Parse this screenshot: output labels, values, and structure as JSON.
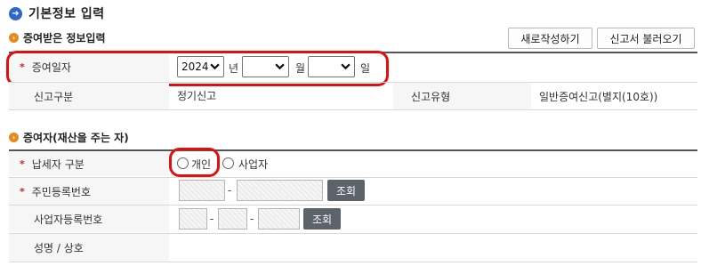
{
  "page": {
    "title": "기본정보 입력",
    "title_icon": "arrow-right-icon"
  },
  "section_recipient": {
    "heading": "증여받은 정보입력",
    "new_button": "새로작성하기",
    "load_button": "신고서 불러오기"
  },
  "gift_date": {
    "label": "증여일자",
    "required_mark": "*",
    "year_value": "2024",
    "year_unit": "년",
    "month_value": "",
    "month_unit": "월",
    "day_value": "",
    "day_unit": "일"
  },
  "report_info": {
    "kind_label": "신고구분",
    "kind_value": "정기신고",
    "type_label": "신고유형",
    "type_value": "일반증여신고(별지(10호))"
  },
  "section_donor": {
    "heading": "증여자(재산을 주는 자)"
  },
  "taxpayer_type": {
    "label": "납세자 구분",
    "required_mark": "*",
    "option_individual": "개인",
    "option_business": "사업자",
    "selected": "none"
  },
  "resident_no": {
    "label": "주민등록번호",
    "required_mark": "*",
    "dash": "-",
    "lookup_button": "조회"
  },
  "business_no": {
    "label": "사업자등록번호",
    "dash": "-",
    "lookup_button": "조회"
  },
  "name": {
    "label": "성명 / 상호"
  },
  "colors": {
    "accent_blue": "#2f66c8",
    "section_orange": "#e88a1a",
    "highlight_red": "#e01010",
    "button_gray": "#5c636b"
  }
}
